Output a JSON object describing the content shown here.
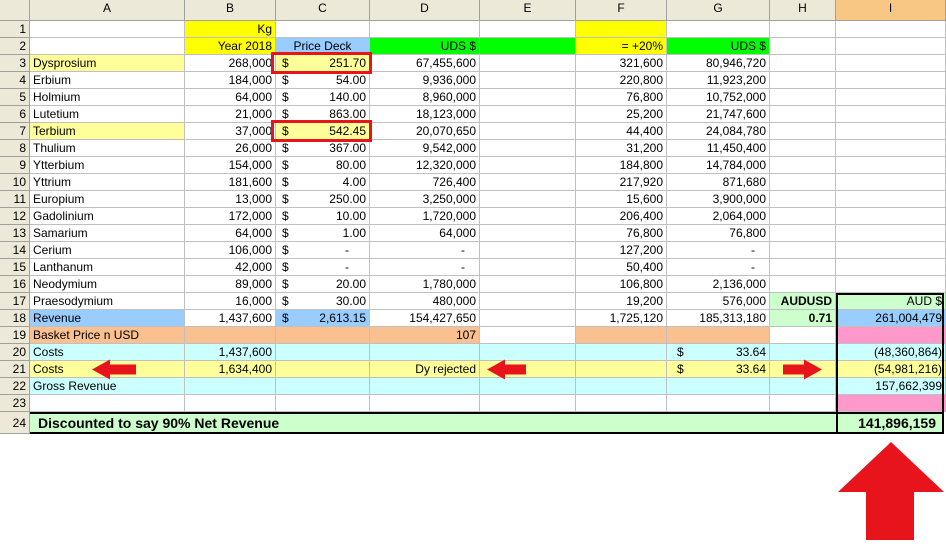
{
  "sheet": {
    "columns": [
      "A",
      "B",
      "C",
      "D",
      "E",
      "F",
      "G",
      "H",
      "I"
    ],
    "selected_column": "I",
    "row_numbers": [
      "1",
      "2",
      "3",
      "4",
      "5",
      "6",
      "7",
      "8",
      "9",
      "10",
      "11",
      "12",
      "13",
      "14",
      "15",
      "16",
      "17",
      "18",
      "19",
      "20",
      "21",
      "22",
      "23",
      "24"
    ],
    "header_row1": {
      "b": "Kg"
    },
    "header_row2": {
      "b": "Year 2018",
      "c": "Price Deck",
      "d": "UDS $",
      "f": "= +20%",
      "g": "UDS $"
    },
    "elements": [
      {
        "name": "Dysprosium",
        "kg": "268,000",
        "price": "251.70",
        "uds": "67,455,600",
        "plus20": "321,600",
        "uds2": "80,946,720"
      },
      {
        "name": "Erbium",
        "kg": "184,000",
        "price": "54.00",
        "uds": "9,936,000",
        "plus20": "220,800",
        "uds2": "11,923,200"
      },
      {
        "name": "Holmium",
        "kg": "64,000",
        "price": "140.00",
        "uds": "8,960,000",
        "plus20": "76,800",
        "uds2": "10,752,000"
      },
      {
        "name": "Lutetium",
        "kg": "21,000",
        "price": "863.00",
        "uds": "18,123,000",
        "plus20": "25,200",
        "uds2": "21,747,600"
      },
      {
        "name": "Terbium",
        "kg": "37,000",
        "price": "542.45",
        "uds": "20,070,650",
        "plus20": "44,400",
        "uds2": "24,084,780"
      },
      {
        "name": "Thulium",
        "kg": "26,000",
        "price": "367.00",
        "uds": "9,542,000",
        "plus20": "31,200",
        "uds2": "11,450,400"
      },
      {
        "name": "Ytterbium",
        "kg": "154,000",
        "price": "80.00",
        "uds": "12,320,000",
        "plus20": "184,800",
        "uds2": "14,784,000"
      },
      {
        "name": "Yttrium",
        "kg": "181,600",
        "price": "4.00",
        "uds": "726,400",
        "plus20": "217,920",
        "uds2": "871,680"
      },
      {
        "name": "Europium",
        "kg": "13,000",
        "price": "250.00",
        "uds": "3,250,000",
        "plus20": "15,600",
        "uds2": "3,900,000"
      },
      {
        "name": "Gadolinium",
        "kg": "172,000",
        "price": "10.00",
        "uds": "1,720,000",
        "plus20": "206,400",
        "uds2": "2,064,000"
      },
      {
        "name": "Samarium",
        "kg": "64,000",
        "price": "1.00",
        "uds": "64,000",
        "plus20": "76,800",
        "uds2": "76,800"
      },
      {
        "name": "Cerium",
        "kg": "106,000",
        "price": "-",
        "uds": "-",
        "plus20": "127,200",
        "uds2": "-"
      },
      {
        "name": "Lanthanum",
        "kg": "42,000",
        "price": "-",
        "uds": "-",
        "plus20": "50,400",
        "uds2": "-"
      },
      {
        "name": "Neodymium",
        "kg": "89,000",
        "price": "20.00",
        "uds": "1,780,000",
        "plus20": "106,800",
        "uds2": "2,136,000"
      },
      {
        "name": "Praesodymium",
        "kg": "16,000",
        "price": "30.00",
        "uds": "480,000",
        "plus20": "19,200",
        "uds2": "576,000"
      }
    ],
    "currency_symbol": "$",
    "row17": {
      "h": "AUDUSD",
      "i": "AUD $"
    },
    "row18": {
      "a": "Revenue",
      "b": "1,437,600",
      "c": "2,613.15",
      "d": "154,427,650",
      "f": "1,725,120",
      "g": "185,313,180",
      "h": "0.71",
      "i": "261,004,479"
    },
    "row19": {
      "a": "Basket Price n USD",
      "d": "107"
    },
    "row20": {
      "a": "Costs",
      "b": "1,437,600",
      "g": "33.64",
      "i": "(48,360,864)"
    },
    "row21": {
      "a": "Costs",
      "b": "1,634,400",
      "d": "Dy rejected",
      "g": "33.64",
      "i": "(54,981,216)"
    },
    "row22": {
      "a": "Gross Revenue",
      "i": "157,662,399"
    },
    "row24": {
      "a": "Discounted to say 90% Net Revenue",
      "i": "141,896,159"
    },
    "colors": {
      "yellow": "#ffff00",
      "light_yellow": "#ffff99",
      "blue_header": "#99ccff",
      "green_header": "#00ff00",
      "peach": "#fac090",
      "light_cyan": "#ccffff",
      "light_green": "#ccffcc",
      "pink": "#ff99cc",
      "red": "#e8141c"
    }
  }
}
